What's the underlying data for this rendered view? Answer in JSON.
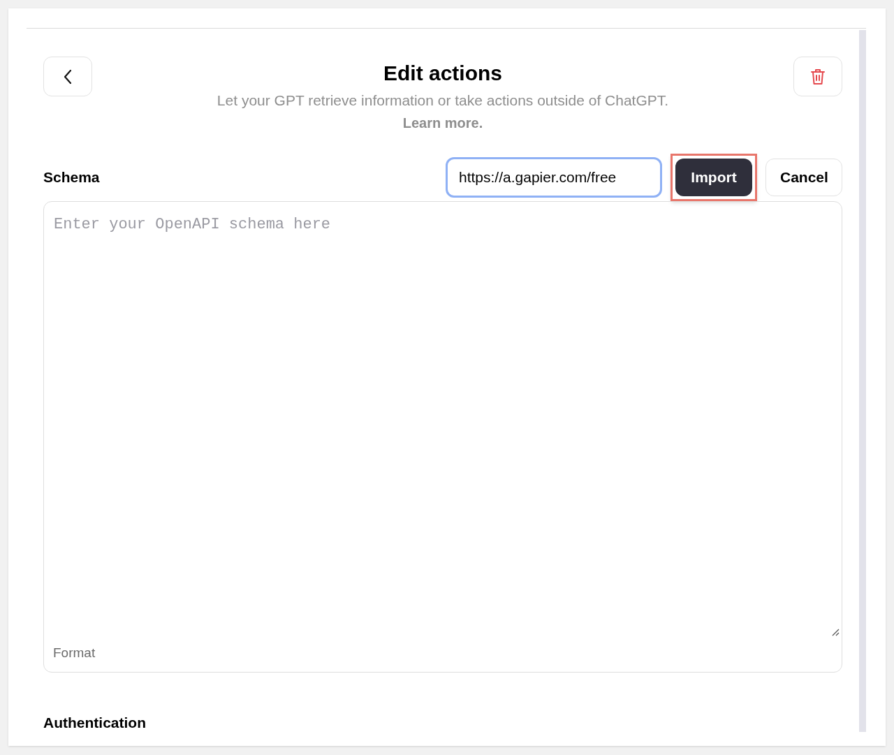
{
  "header": {
    "title": "Edit actions",
    "subtitle": "Let your GPT retrieve information or take actions outside of ChatGPT.",
    "link": "Learn more."
  },
  "schema": {
    "label": "Schema",
    "url_field": {
      "value": "https://a.gapier.com/free",
      "focused": true
    },
    "buttons": [
      {
        "label": "Import",
        "kind": "primary",
        "highlighted": true
      },
      {
        "label": "Cancel",
        "kind": "secondary",
        "highlighted": false
      }
    ],
    "editor": {
      "placeholder": "Enter your OpenAPI schema here",
      "footer": "Format"
    }
  },
  "authentication": {
    "label": "Authentication"
  }
}
